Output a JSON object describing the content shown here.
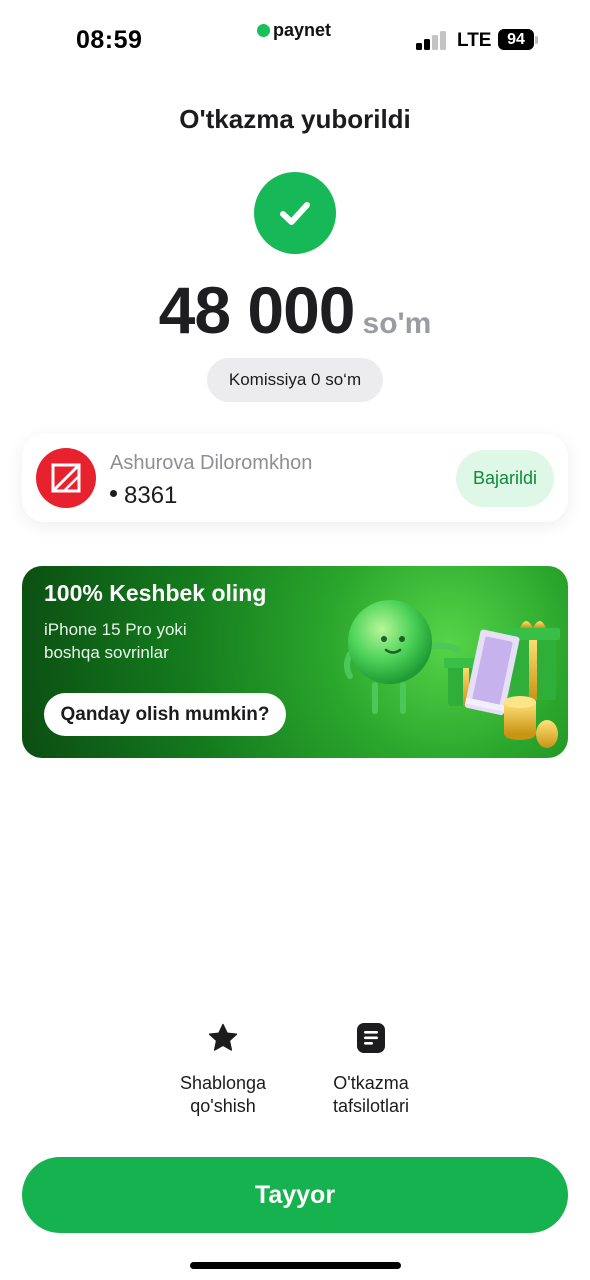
{
  "status_bar": {
    "time": "08:59",
    "brand": "paynet",
    "carrier": "LTE",
    "battery": "94",
    "signal_bars_active": 2
  },
  "header": {
    "title": "O'tkazma yuborildi"
  },
  "transfer": {
    "amount": "48 000",
    "currency": "so'm",
    "commission": "Komissiya 0 so‘m"
  },
  "recipient": {
    "name": "Ashurova Diloromkhon",
    "card_last4": "8361",
    "status": "Bajarildi"
  },
  "promo": {
    "title": "100% Keshbek oling",
    "subtitle": "iPhone 15 Pro yoki boshqa sovrinlar",
    "button": "Qanday olish mumkin?"
  },
  "actions": [
    {
      "label": "Shablonga\nqo'shish",
      "icon": "star-icon"
    },
    {
      "label": "O'tkazma\ntafsilotlari",
      "icon": "document-icon"
    }
  ],
  "footer": {
    "done_button": "Tayyor"
  },
  "colors": {
    "accent_green": "#16b24f",
    "success_check": "#17b857",
    "bank_red": "#e8212e",
    "badge_bg": "#dff7e6",
    "badge_text": "#0f8a3b"
  }
}
